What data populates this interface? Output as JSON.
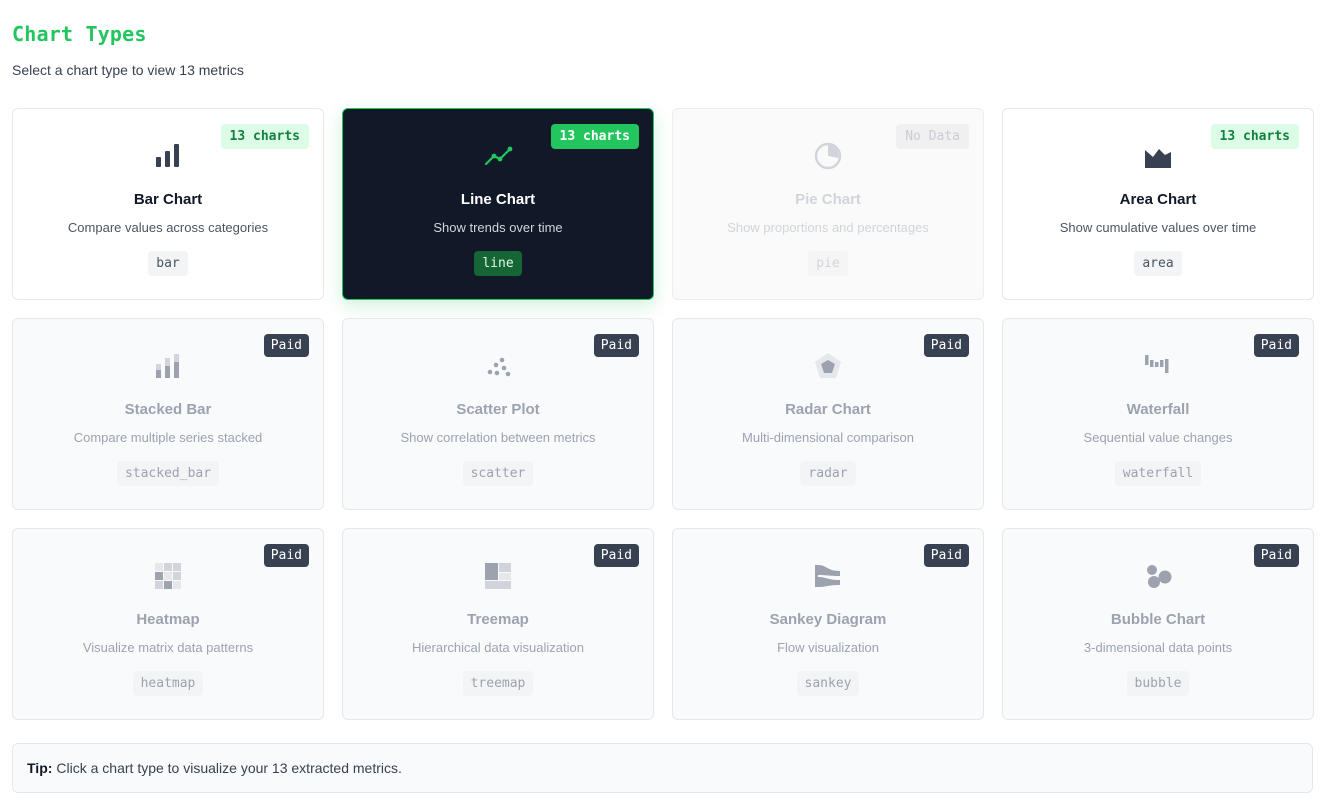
{
  "header": {
    "title": "Chart Types",
    "subtitle": "Select a chart type to view 13 metrics"
  },
  "colors": {
    "accent": "#22c55e",
    "selected_bg": "#111827",
    "paid_badge": "#374151"
  },
  "cards": [
    {
      "title": "Bar Chart",
      "desc": "Compare values across categories",
      "tag": "bar",
      "badge": "13 charts",
      "icon": "bar-chart-icon",
      "state": "available"
    },
    {
      "title": "Line Chart",
      "desc": "Show trends over time",
      "tag": "line",
      "badge": "13 charts",
      "icon": "line-chart-icon",
      "state": "selected"
    },
    {
      "title": "Pie Chart",
      "desc": "Show proportions and percentages",
      "tag": "pie",
      "badge": "No Data",
      "icon": "pie-chart-icon",
      "state": "disabled"
    },
    {
      "title": "Area Chart",
      "desc": "Show cumulative values over time",
      "tag": "area",
      "badge": "13 charts",
      "icon": "area-chart-icon",
      "state": "available"
    },
    {
      "title": "Stacked Bar",
      "desc": "Compare multiple series stacked",
      "tag": "stacked_bar",
      "badge": "Paid",
      "icon": "stacked-bar-icon",
      "state": "locked"
    },
    {
      "title": "Scatter Plot",
      "desc": "Show correlation between metrics",
      "tag": "scatter",
      "badge": "Paid",
      "icon": "scatter-plot-icon",
      "state": "locked"
    },
    {
      "title": "Radar Chart",
      "desc": "Multi-dimensional comparison",
      "tag": "radar",
      "badge": "Paid",
      "icon": "radar-chart-icon",
      "state": "locked"
    },
    {
      "title": "Waterfall",
      "desc": "Sequential value changes",
      "tag": "waterfall",
      "badge": "Paid",
      "icon": "waterfall-chart-icon",
      "state": "locked"
    },
    {
      "title": "Heatmap",
      "desc": "Visualize matrix data patterns",
      "tag": "heatmap",
      "badge": "Paid",
      "icon": "heatmap-icon",
      "state": "locked"
    },
    {
      "title": "Treemap",
      "desc": "Hierarchical data visualization",
      "tag": "treemap",
      "badge": "Paid",
      "icon": "treemap-icon",
      "state": "locked"
    },
    {
      "title": "Sankey Diagram",
      "desc": "Flow visualization",
      "tag": "sankey",
      "badge": "Paid",
      "icon": "sankey-icon",
      "state": "locked"
    },
    {
      "title": "Bubble Chart",
      "desc": "3-dimensional data points",
      "tag": "bubble",
      "badge": "Paid",
      "icon": "bubble-chart-icon",
      "state": "locked"
    }
  ],
  "tip": {
    "label": "Tip:",
    "text": "Click a chart type to visualize your 13 extracted metrics."
  }
}
